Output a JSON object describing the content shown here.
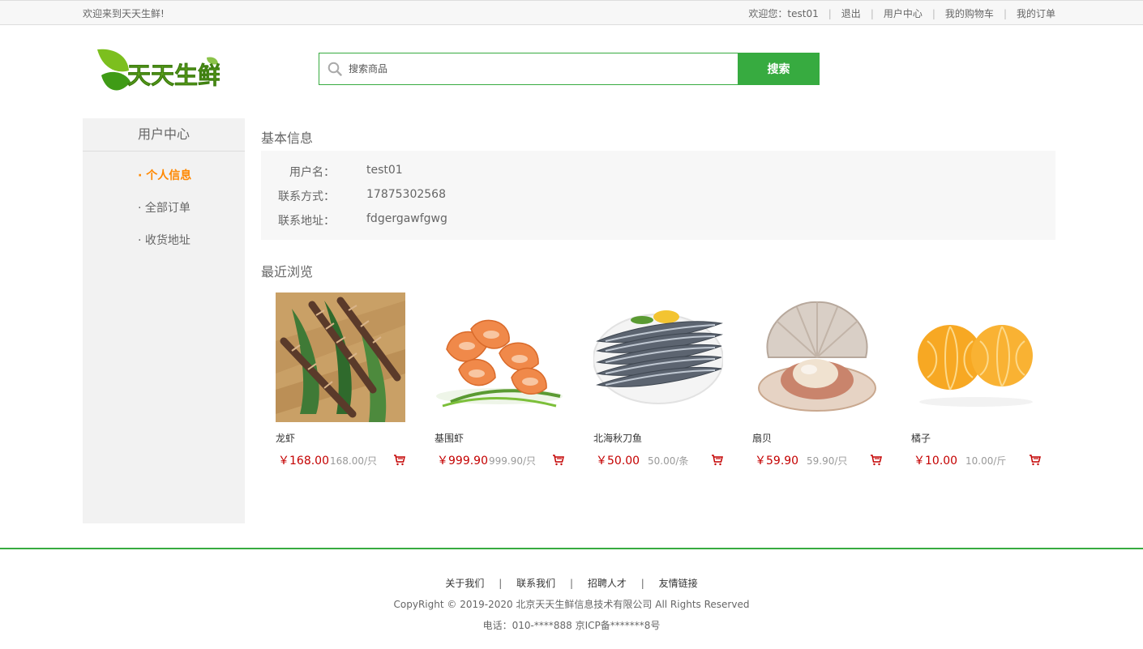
{
  "topbar": {
    "welcome": "欢迎来到天天生鲜!",
    "greeting": "欢迎您：",
    "username": "test01",
    "links": [
      "退出",
      "用户中心",
      "我的购物车",
      "我的订单"
    ]
  },
  "logo": {
    "text": "天天生鲜"
  },
  "search": {
    "placeholder": "搜索商品",
    "button": "搜索"
  },
  "sidebar": {
    "title": "用户中心",
    "items": [
      {
        "label": "· 个人信息",
        "active": true
      },
      {
        "label": "· 全部订单",
        "active": false
      },
      {
        "label": "· 收货地址",
        "active": false
      }
    ]
  },
  "basic_info": {
    "title": "基本信息",
    "rows": [
      {
        "label": "用户名：",
        "value": "test01"
      },
      {
        "label": "联系方式：",
        "value": "17875302568"
      },
      {
        "label": "联系地址：",
        "value": "fdgergawfgwg"
      }
    ]
  },
  "recent": {
    "title": "最近浏览",
    "items": [
      {
        "name": "龙虾",
        "price": "￥168.00",
        "unit": "168.00/只",
        "image": "lobster"
      },
      {
        "name": "基围虾",
        "price": "￥999.90",
        "unit": "999.90/只",
        "image": "shrimp"
      },
      {
        "name": "北海秋刀鱼",
        "price": "￥50.00",
        "unit": "50.00/条",
        "image": "saury"
      },
      {
        "name": "扇贝",
        "price": "￥59.90",
        "unit": "59.90/只",
        "image": "scallop"
      },
      {
        "name": "橘子",
        "price": "￥10.00",
        "unit": "10.00/斤",
        "image": "orange"
      }
    ]
  },
  "footer": {
    "links": [
      "关于我们",
      "联系我们",
      "招聘人才",
      "友情链接"
    ],
    "copyright": "CopyRight © 2019-2020 北京天天生鲜信息技术有限公司 All Rights Reserved",
    "tel": "电话：010-****888 京ICP备*******8号"
  },
  "colors": {
    "brand_green": "#37ab40",
    "active_orange": "#ff8800",
    "price_red": "#c40000"
  }
}
